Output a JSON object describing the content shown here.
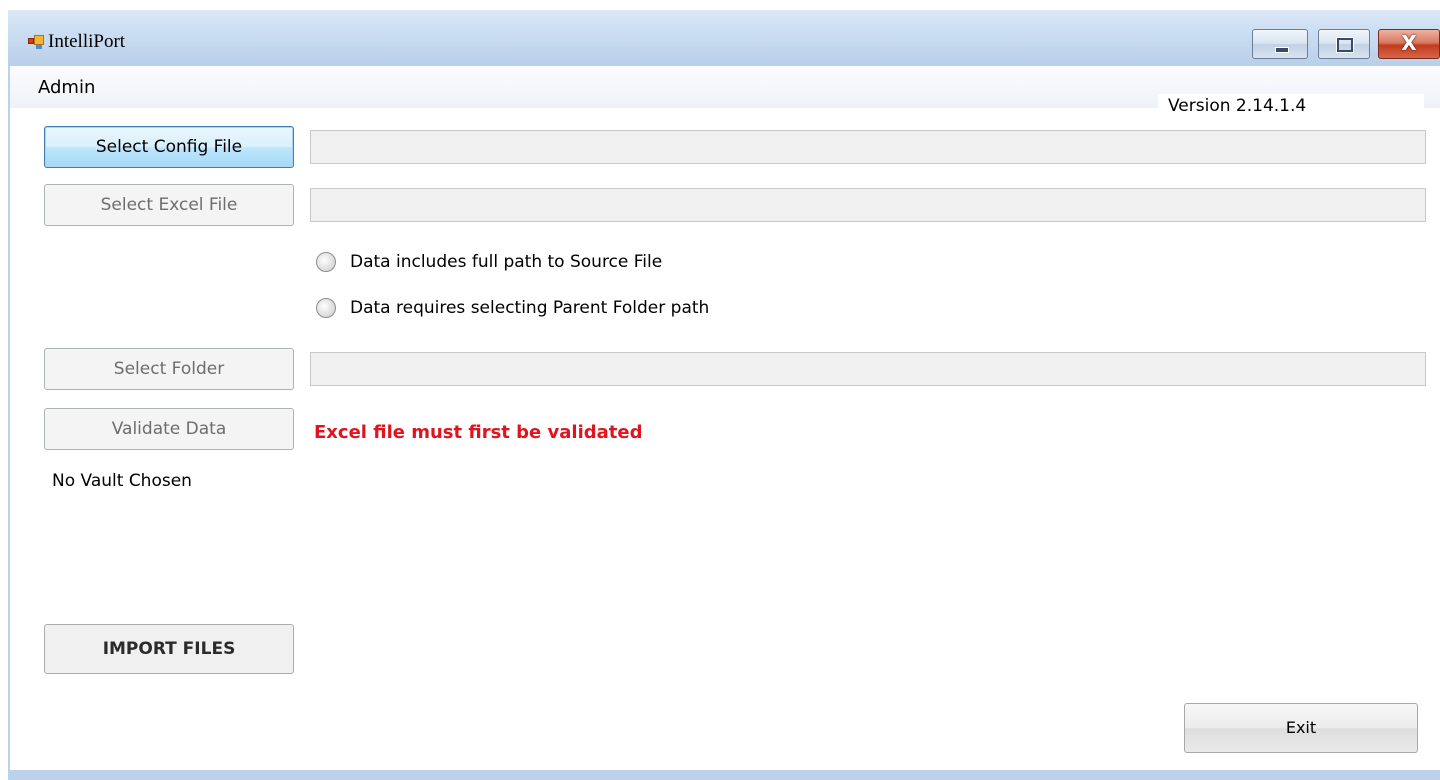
{
  "window": {
    "title": "IntelliPort",
    "app_icon": "intelliport-app-icon",
    "controls": {
      "minimize_icon": "minimize-icon",
      "maximize_icon": "maximize-icon",
      "close_glyph": "X"
    }
  },
  "menu": {
    "admin_label": "Admin"
  },
  "version_label": "Version 2.14.1.4",
  "config": {
    "button_label": "Select Config File",
    "path_value": ""
  },
  "excel": {
    "button_label": "Select Excel File",
    "path_value": ""
  },
  "path_options": [
    {
      "label": "Data includes full path to Source File",
      "selected": false
    },
    {
      "label": "Data requires selecting Parent Folder path",
      "selected": false
    }
  ],
  "folder": {
    "button_label": "Select Folder",
    "path_value": ""
  },
  "validate": {
    "button_label": "Validate Data",
    "message": "Excel file must first be validated",
    "message_color": "#e0141e"
  },
  "vault_status": "No Vault Chosen",
  "import_button_label": "IMPORT FILES",
  "exit_button_label": "Exit",
  "colors": {
    "titlebar": "#c9dcf1",
    "focus_accent": "#3c7fb1",
    "close_button": "#c23b1e"
  }
}
